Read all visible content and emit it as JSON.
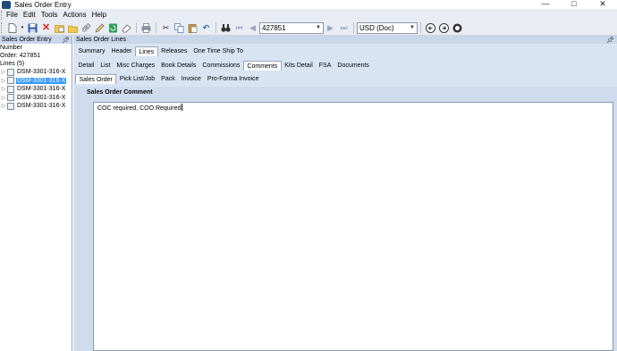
{
  "window": {
    "title": "Sales Order Entry",
    "minimize": "—",
    "maximize": "□",
    "close": "✕"
  },
  "menu": [
    "File",
    "Edit",
    "Tools",
    "Actions",
    "Help"
  ],
  "toolbar": {
    "order_number": "427851",
    "currency": "USD (Doc)"
  },
  "left_panel": {
    "header": "Sales Order Entry",
    "line1": "Number",
    "line2": "Order: 427851",
    "line3": "Lines (5)",
    "items": [
      {
        "label": "DSM-3301-316-X"
      },
      {
        "label": "DSM-3301-316-X"
      },
      {
        "label": "DSM-3301-316-X"
      },
      {
        "label": "DSM-3301-316-X"
      },
      {
        "label": "DSM-3301-316-X"
      }
    ]
  },
  "main_panel": {
    "header": "Sales Order Lines",
    "tabs_row1": [
      "Summary",
      "Header",
      "Lines",
      "Releases",
      "One Time Ship To"
    ],
    "tabs_row2": [
      "Detail",
      "List",
      "Misc Charges",
      "Book Details",
      "Commissions",
      "Comments",
      "Kits Detail",
      "FSA",
      "Documents"
    ],
    "tabs_row3": [
      "Sales Order",
      "Pick List/Job",
      "Pack",
      "Invoice",
      "Pro-Forma Invoice"
    ],
    "comment_title": "Sales Order Comment",
    "comment_text": "COC required, COO Required"
  }
}
